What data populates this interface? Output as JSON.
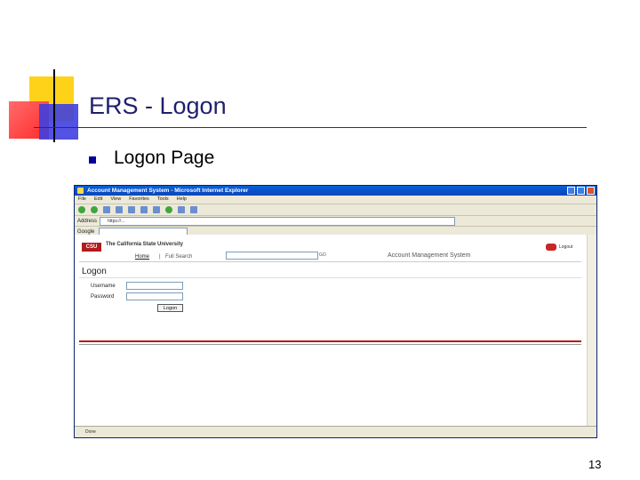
{
  "slide": {
    "title": "ERS - Logon",
    "bullet": "Logon Page",
    "page_number": "13"
  },
  "browser": {
    "window_title": "Account Management System - Microsoft Internet Explorer",
    "menu": [
      "File",
      "Edit",
      "View",
      "Favorites",
      "Tools",
      "Help"
    ],
    "address_label": "Address",
    "address_value": "https://...",
    "google_label": "Google",
    "status_text": "Done"
  },
  "page": {
    "logo_text": "CSU",
    "university_name": "The California State University",
    "nav_home": "Home",
    "nav_separator": "|",
    "nav_search": "Full Search",
    "go_label": "GO",
    "system_title": "Account Management System",
    "logout_label": "Logout",
    "logon_heading": "Logon",
    "username_label": "Username",
    "password_label": "Password",
    "logon_button": "Logon"
  },
  "colors": {
    "slide_title": "#1f1f6e",
    "csu_red": "#b31b1b",
    "ie_titlebar": "#0a5fd8"
  }
}
